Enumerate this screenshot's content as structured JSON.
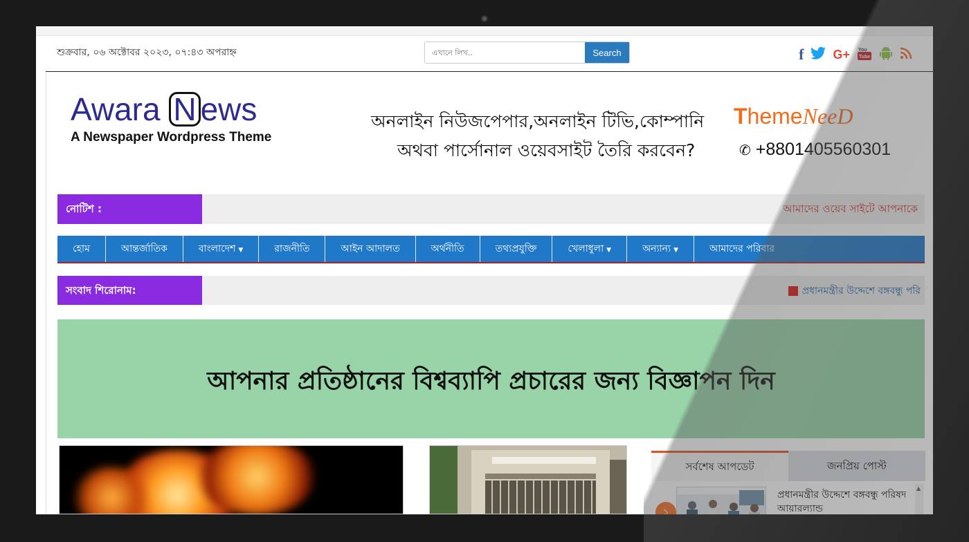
{
  "topbar": {
    "date": "শুক্রবার, ০৬ অক্টোবর ২০২৩, ০৭:৪৩ অপরাহ্ন",
    "search_placeholder": "এখানে লিখ..",
    "search_button": "Search",
    "social": [
      {
        "icon": "facebook-icon",
        "glyph": "f",
        "color": "#3b5998"
      },
      {
        "icon": "twitter-icon",
        "glyph": "🐦",
        "color": "#1da1f2"
      },
      {
        "icon": "google-plus-icon",
        "glyph": "G+",
        "color": "#dd4b39"
      },
      {
        "icon": "youtube-icon",
        "glyph": "You Tube",
        "color": "#cc181e"
      },
      {
        "icon": "android-icon",
        "glyph": "▲",
        "color": "#8bc34a"
      },
      {
        "icon": "rss-icon",
        "glyph": "))",
        "color": "#f26522"
      }
    ]
  },
  "header": {
    "logo_part1": "Awara ",
    "logo_n": "N",
    "logo_part2": "ews",
    "logo_tagline": "A Newspaper Wordpress Theme",
    "ad_line1": "অনলাইন নিউজপেপার,অনলাইন টিভি,কোম্পানি",
    "ad_line2": "অথবা পার্সোনাল ওয়েবসাইট তৈরি করবেন?",
    "brand_t": "T",
    "brand_heme": "heme",
    "brand_need": "NeeD",
    "phone": "+8801405560301",
    "colors": {
      "logo": "#2d2b8f",
      "brand": "#f36b1b"
    }
  },
  "notice": {
    "label": "নোটিশ :",
    "text": "আমাদের ওয়েব সাইটে আপনাকে"
  },
  "nav": {
    "items": [
      {
        "label": "হোম",
        "dropdown": false
      },
      {
        "label": "আন্তর্জাতিক",
        "dropdown": false
      },
      {
        "label": "বাংলাদেশ",
        "dropdown": true
      },
      {
        "label": "রাজনীতি",
        "dropdown": false
      },
      {
        "label": "আইন আদালত",
        "dropdown": false
      },
      {
        "label": "অর্থনীতি",
        "dropdown": false
      },
      {
        "label": "তথ্যপ্রযুক্তি",
        "dropdown": false
      },
      {
        "label": "খেলাধুলা",
        "dropdown": true
      },
      {
        "label": "অন্যান্য",
        "dropdown": true
      },
      {
        "label": "আমাদের পরিবার",
        "dropdown": false
      }
    ],
    "color": "#1f78c8"
  },
  "headline": {
    "label": "সংবাদ শিরোনাম:",
    "text": "প্রধানমন্ত্রীর উদ্দেশে বঙ্গবন্ধু পরি"
  },
  "banner": {
    "text": "আপনার প্রতিষ্ঠানের বিশ্বব্যাপি প্রচারের জন্য বিজ্ঞাপন দিন",
    "color": "#98d4a8"
  },
  "sidebar": {
    "tabs": [
      {
        "label": "সর্বশেষ আপডেট",
        "active": true
      },
      {
        "label": "জনপ্রিয় পোস্ট",
        "active": false
      }
    ],
    "posts": [
      {
        "number": "১",
        "title": "প্রধানমন্ত্রীর উদ্দেশে বঙ্গবন্ধু পরিষদ আয়ারল্যান্ড"
      }
    ]
  }
}
